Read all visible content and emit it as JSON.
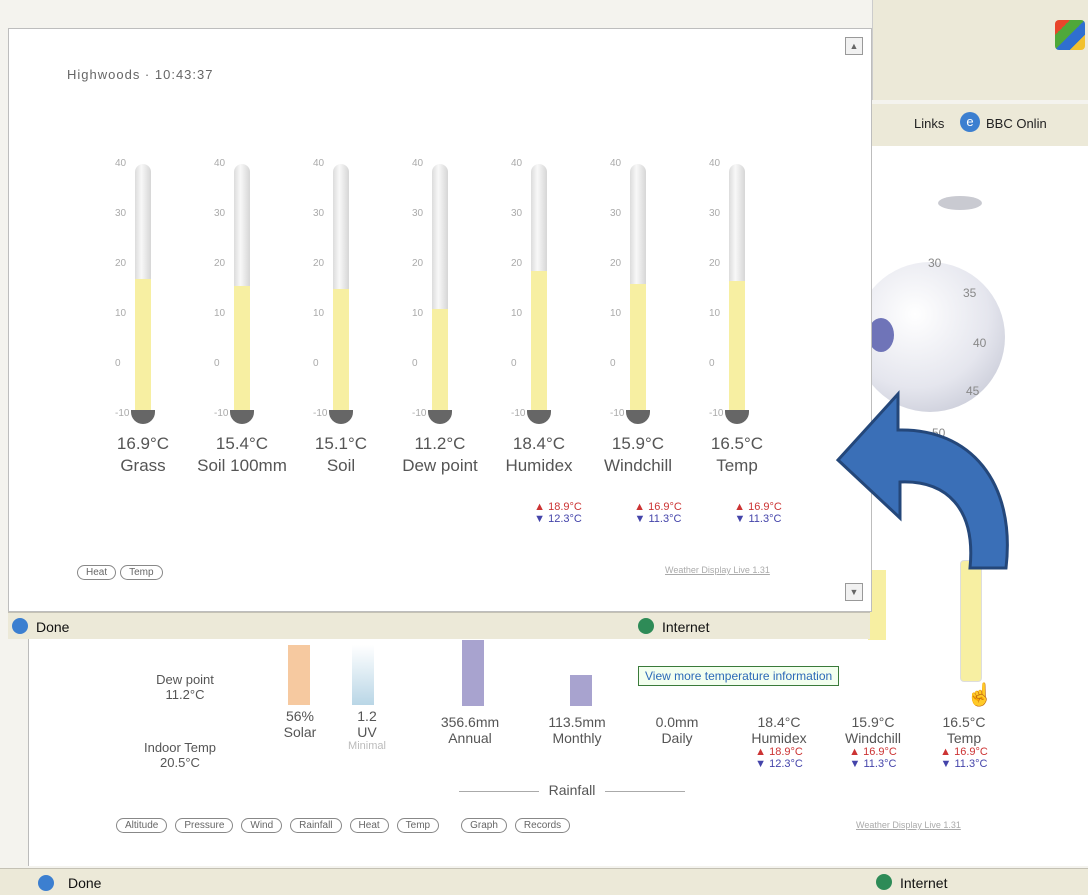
{
  "popup": {
    "station_time": "Highwoods · 10:43:37",
    "thermometers": [
      {
        "value": "16.9°C",
        "name": "Grass",
        "level": 0.54
      },
      {
        "value": "15.4°C",
        "name": "Soil 100mm",
        "level": 0.51
      },
      {
        "value": "15.1°C",
        "name": "Soil",
        "level": 0.5
      },
      {
        "value": "11.2°C",
        "name": "Dew point",
        "level": 0.42
      },
      {
        "value": "18.4°C",
        "name": "Humidex",
        "level": 0.57
      },
      {
        "value": "15.9°C",
        "name": "Windchill",
        "level": 0.52
      },
      {
        "value": "16.5°C",
        "name": "Temp",
        "level": 0.53
      }
    ],
    "scale_ticks": [
      "40",
      "30",
      "20",
      "10",
      "0",
      "-10"
    ],
    "extremes": [
      {
        "hi": "▲ 18.9°C",
        "lo": "▼ 12.3°C"
      },
      {
        "hi": "▲ 16.9°C",
        "lo": "▼ 11.3°C"
      },
      {
        "hi": "▲ 16.9°C",
        "lo": "▼ 11.3°C"
      }
    ],
    "buttons": [
      "Heat",
      "Temp"
    ],
    "footer_link": "Weather Display Live 1.31",
    "status": {
      "text": "Done",
      "zone": "Internet"
    }
  },
  "background": {
    "links_label": "Links",
    "bbc_label": "BBC Onlin",
    "dial_ticks": [
      "30",
      "35",
      "40",
      "45",
      "50"
    ],
    "dew_point_label": "Dew point",
    "dew_point_value": "11.2°C",
    "indoor_label": "Indoor Temp",
    "indoor_value": "20.5°C",
    "solar": {
      "value": "56%",
      "label": "Solar"
    },
    "uv": {
      "value": "1.2",
      "label": "UV",
      "sub": "Minimal"
    },
    "rain_annual": {
      "value": "356.6mm",
      "label": "Annual"
    },
    "rain_monthly": {
      "value": "113.5mm",
      "label": "Monthly"
    },
    "rain_daily": {
      "value": "0.0mm",
      "label": "Daily"
    },
    "rainfall_label": "Rainfall",
    "temps": [
      {
        "value": "18.4°C",
        "label": "Humidex",
        "hi": "▲ 18.9°C",
        "lo": "▼ 12.3°C"
      },
      {
        "value": "15.9°C",
        "label": "Windchill",
        "hi": "▲ 16.9°C",
        "lo": "▼ 11.3°C"
      },
      {
        "value": "16.5°C",
        "label": "Temp",
        "hi": "▲ 16.9°C",
        "lo": "▼ 11.3°C"
      }
    ],
    "nav_buttons": [
      "Altitude",
      "Pressure",
      "Wind",
      "Rainfall",
      "Heat",
      "Temp",
      "Graph",
      "Records"
    ],
    "footer_link": "Weather Display Live 1.31",
    "tooltip": "View more temperature information",
    "status": {
      "text": "Done",
      "zone": "Internet"
    }
  },
  "colors": {
    "fill": "#f7efa2",
    "tube": "#ececec",
    "arrow": "#3a6fb7"
  }
}
